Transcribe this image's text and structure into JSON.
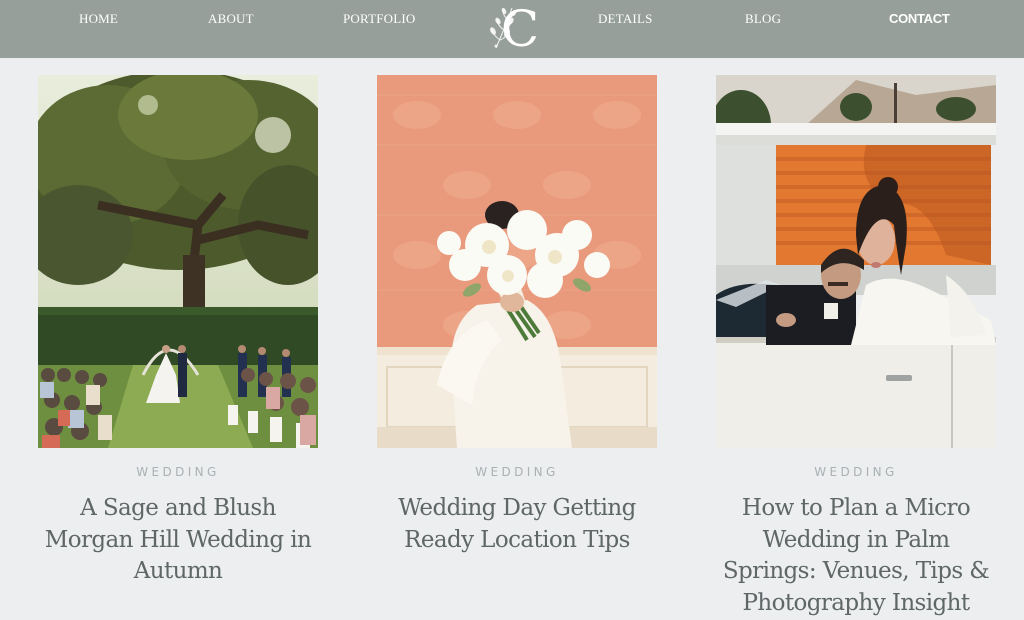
{
  "nav": {
    "items": [
      {
        "label": "HOME"
      },
      {
        "label": "ABOUT"
      },
      {
        "label": "PORTFOLIO"
      },
      {
        "label": "DETAILS"
      },
      {
        "label": "BLOG"
      },
      {
        "label": "CONTACT"
      }
    ],
    "logo_icon": "monogram-c-floral-icon",
    "logo_letter": "C"
  },
  "posts": [
    {
      "category": "WEDDING",
      "title": "A Sage and Blush Morgan Hill Wedding in Autumn",
      "image": "outdoor-oak-tree-ceremony-photo"
    },
    {
      "category": "WEDDING",
      "title": "Wedding Day Getting Ready Location Tips",
      "image": "bride-holding-bouquet-photo"
    },
    {
      "category": "WEDDING",
      "title": "How to Plan a Micro Wedding in Palm Springs: Venues, Tips & Photography Insight",
      "image": "couple-in-vintage-convertible-photo"
    }
  ],
  "colors": {
    "nav_background": "#969f99",
    "page_background": "#eceef0",
    "category_text": "#a9b1b3",
    "title_text": "#5f6666"
  }
}
